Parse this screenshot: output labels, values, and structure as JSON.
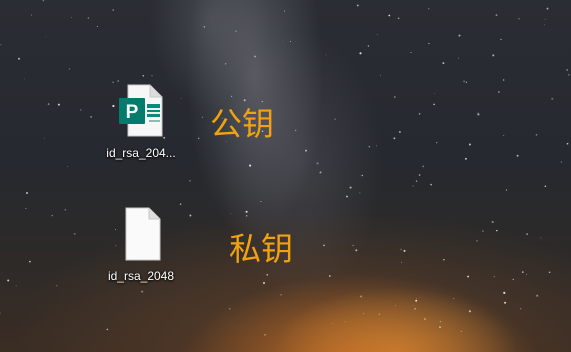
{
  "desktop": {
    "icons": [
      {
        "label": "id_rsa_204...",
        "icon": "publisher-file-icon",
        "icon_letter": "P",
        "icon_color": "#037c6e"
      },
      {
        "label": "id_rsa_2048",
        "icon": "blank-file-icon"
      }
    ],
    "annotations": [
      {
        "text": "公钥",
        "color": "#f2a20f"
      },
      {
        "text": "私钥",
        "color": "#f2a20f"
      }
    ]
  }
}
